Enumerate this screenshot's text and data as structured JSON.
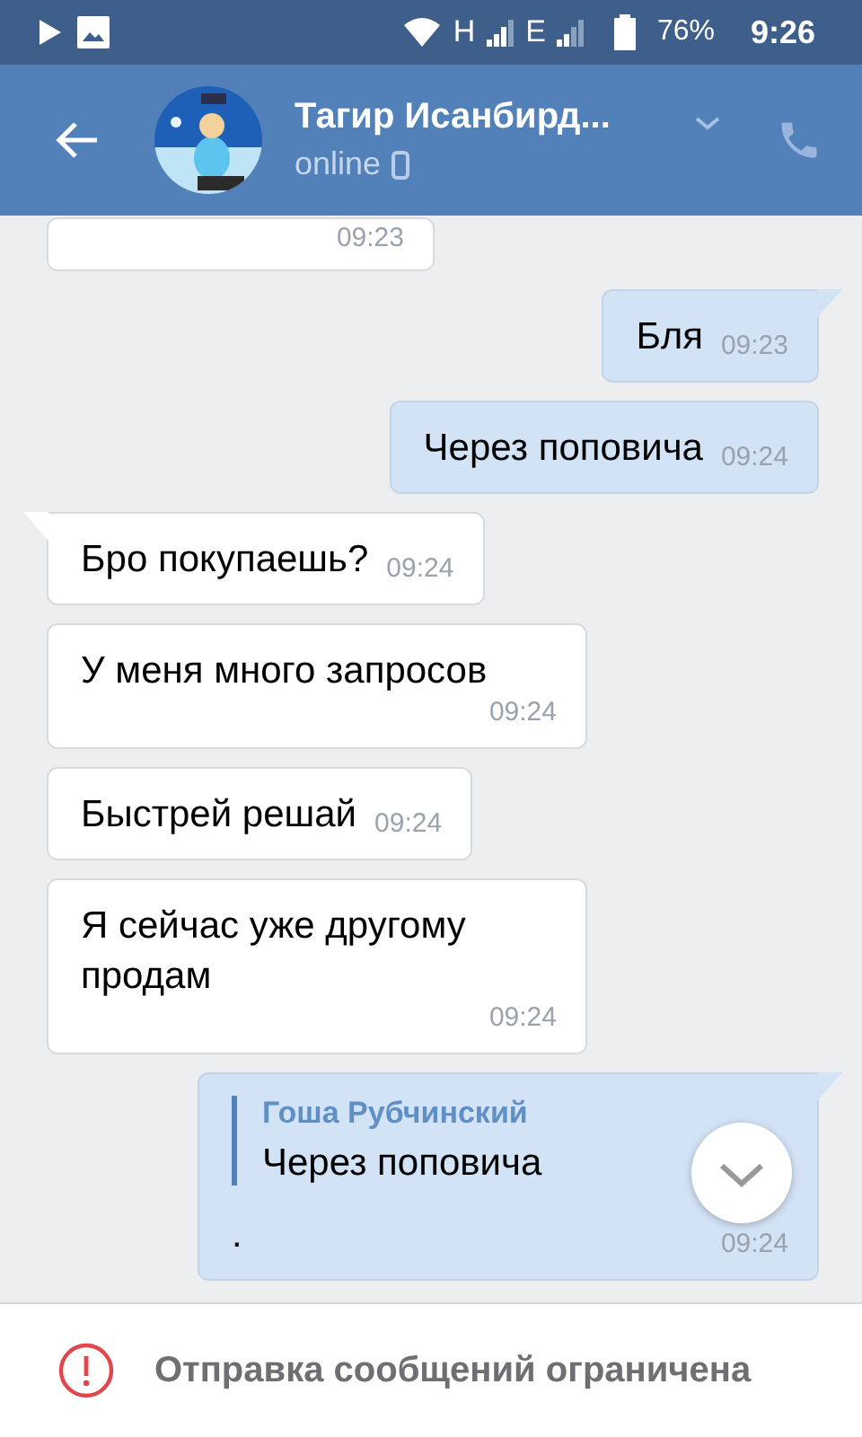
{
  "status_bar": {
    "network_1": "H",
    "network_2": "E",
    "battery": "76%",
    "time": "9:26"
  },
  "header": {
    "title": "Тагир Исанбирд...",
    "status": "online"
  },
  "messages": [
    {
      "kind": "incoming",
      "time": "09:23"
    },
    {
      "kind": "outgoing",
      "tail": true,
      "text": "Бля",
      "time": "09:23"
    },
    {
      "kind": "outgoing",
      "tail": false,
      "text": "Через поповича",
      "time": "09:24"
    },
    {
      "kind": "incoming",
      "tail": true,
      "text": "Бро покупаешь?",
      "time": "09:24"
    },
    {
      "kind": "incoming",
      "tail": false,
      "text": "У меня много запросов",
      "time": "09:24"
    },
    {
      "kind": "incoming",
      "tail": false,
      "text": "Быстрей решай",
      "time": "09:24"
    },
    {
      "kind": "incoming",
      "tail": false,
      "text": "Я сейчас уже другому продам",
      "time": "09:24"
    },
    {
      "kind": "outgoing",
      "tail": true,
      "reply": {
        "author": "Гоша Рубчинский",
        "text": "Через поповича"
      },
      "text": ".",
      "time": "09:24"
    }
  ],
  "notice": "Отправка сообщений ограничена"
}
